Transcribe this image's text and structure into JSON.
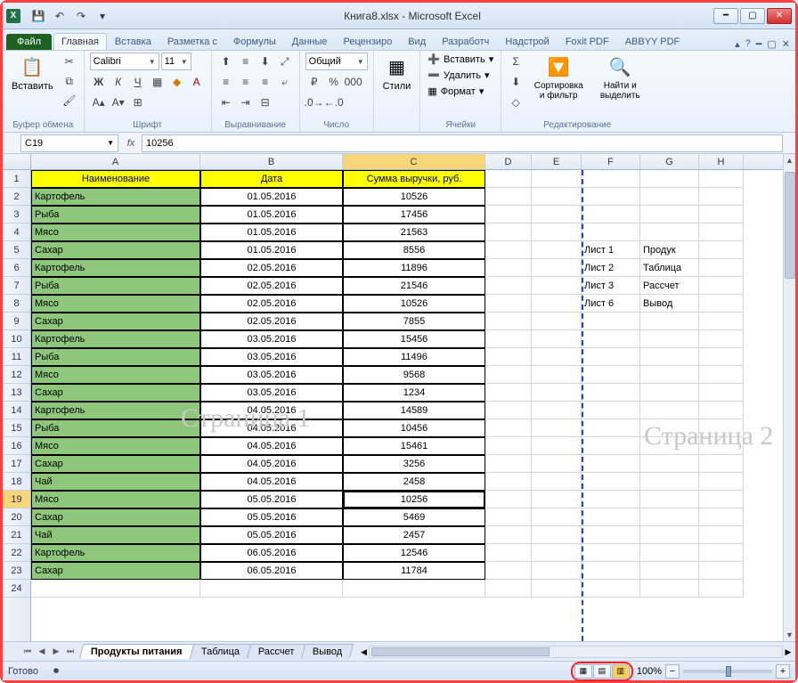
{
  "title": "Книга8.xlsx - Microsoft Excel",
  "qat": {
    "save": "💾",
    "undo": "↶",
    "redo": "↷"
  },
  "tabs": {
    "file": "Файл",
    "list": [
      "Главная",
      "Вставка",
      "Разметка с",
      "Формулы",
      "Данные",
      "Рецензиро",
      "Вид",
      "Разработч",
      "Надстрой",
      "Foxit PDF",
      "ABBYY PDF"
    ],
    "active": 0
  },
  "ribbon": {
    "clipboard": {
      "paste": "Вставить",
      "label": "Буфер обмена"
    },
    "font": {
      "name": "Calibri",
      "size": "11",
      "label": "Шрифт"
    },
    "align": {
      "label": "Выравнивание"
    },
    "number": {
      "format": "Общий",
      "label": "Число"
    },
    "styles": {
      "btn": "Стили",
      "label": ""
    },
    "cells": {
      "insert": "Вставить",
      "delete": "Удалить",
      "format": "Формат",
      "label": "Ячейки"
    },
    "editing": {
      "sort": "Сортировка и фильтр",
      "find": "Найти и выделить",
      "label": "Редактирование"
    }
  },
  "formula_bar": {
    "name_box": "C19",
    "formula": "10256"
  },
  "columns": [
    {
      "id": "A",
      "w": 190
    },
    {
      "id": "B",
      "w": 160
    },
    {
      "id": "C",
      "w": 160
    },
    {
      "id": "D",
      "w": 52
    },
    {
      "id": "E",
      "w": 56
    },
    {
      "id": "F",
      "w": 66
    },
    {
      "id": "G",
      "w": 66
    },
    {
      "id": "H",
      "w": 50
    }
  ],
  "headers": [
    "Наименование",
    "Дата",
    "Сумма выручки, руб."
  ],
  "rows": [
    {
      "n": "Картофель",
      "d": "01.05.2016",
      "v": "10526"
    },
    {
      "n": "Рыба",
      "d": "01.05.2016",
      "v": "17456"
    },
    {
      "n": "Мясо",
      "d": "01.05.2016",
      "v": "21563"
    },
    {
      "n": "Сахар",
      "d": "01.05.2016",
      "v": "8556"
    },
    {
      "n": "Картофель",
      "d": "02.05.2016",
      "v": "11896"
    },
    {
      "n": "Рыба",
      "d": "02.05.2016",
      "v": "21546"
    },
    {
      "n": "Мясо",
      "d": "02.05.2016",
      "v": "10526"
    },
    {
      "n": "Сахар",
      "d": "02.05.2016",
      "v": "7855"
    },
    {
      "n": "Картофель",
      "d": "03.05.2016",
      "v": "15456"
    },
    {
      "n": "Рыба",
      "d": "03.05.2016",
      "v": "11496"
    },
    {
      "n": "Мясо",
      "d": "03.05.2016",
      "v": "9568"
    },
    {
      "n": "Сахар",
      "d": "03.05.2016",
      "v": "1234"
    },
    {
      "n": "Картофель",
      "d": "04.05.2016",
      "v": "14589"
    },
    {
      "n": "Рыба",
      "d": "04.05.2016",
      "v": "10456"
    },
    {
      "n": "Мясо",
      "d": "04.05.2016",
      "v": "15461"
    },
    {
      "n": "Сахар",
      "d": "04.05.2016",
      "v": "3256"
    },
    {
      "n": "Чай",
      "d": "04.05.2016",
      "v": "2458"
    },
    {
      "n": "Мясо",
      "d": "05.05.2016",
      "v": "10256"
    },
    {
      "n": "Сахар",
      "d": "05.05.2016",
      "v": "5469"
    },
    {
      "n": "Чай",
      "d": "05.05.2016",
      "v": "2457"
    },
    {
      "n": "Картофель",
      "d": "06.05.2016",
      "v": "12546"
    },
    {
      "n": "Сахар",
      "d": "06.05.2016",
      "v": "11784"
    }
  ],
  "active_cell": {
    "row": 19,
    "col": "C"
  },
  "side_list": [
    {
      "a": "Лист 1",
      "b": "Продук"
    },
    {
      "a": "Лист 2",
      "b": "Таблица"
    },
    {
      "a": "Лист 3",
      "b": "Рассчет"
    },
    {
      "a": "Лист 6",
      "b": "Вывод"
    }
  ],
  "watermarks": {
    "p1": "Страница 1",
    "p2": "Страница 2"
  },
  "sheets": {
    "list": [
      "Продукты питания",
      "Таблица",
      "Рассчет",
      "Вывод"
    ],
    "active": 0
  },
  "status": {
    "ready": "Готово",
    "zoom": "100%"
  }
}
